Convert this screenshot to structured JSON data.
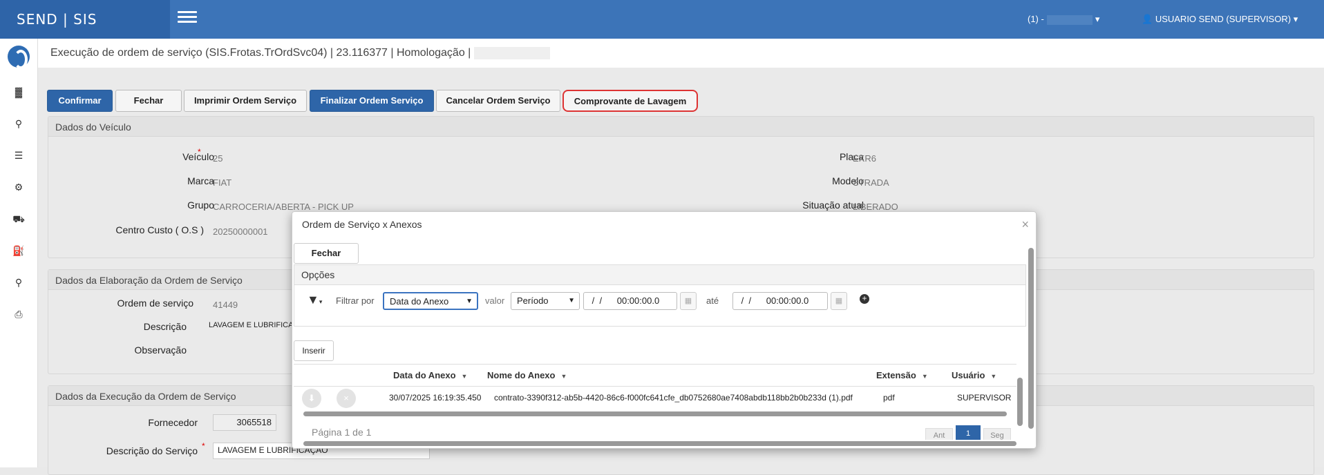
{
  "topbar": {
    "brand": "SEND | SIS",
    "selector_label": "(1) -",
    "user_label": "USUARIO SEND (SUPERVISOR)"
  },
  "sidebar": {
    "icons": [
      "chart-icon",
      "key-icon",
      "list-icon",
      "cogs-icon",
      "truck-icon",
      "gas-pump-icon",
      "search-icon",
      "print-icon"
    ]
  },
  "page": {
    "title": "Execução de ordem de serviço (SIS.Frotas.TrOrdSvc04) | 23.116377 | Homologação |"
  },
  "toolbar": {
    "confirm": "Confirmar",
    "close": "Fechar",
    "print": "Imprimir Ordem Serviço",
    "finish": "Finalizar Ordem Serviço",
    "cancel": "Cancelar Ordem Serviço",
    "wash_receipt": "Comprovante de Lavagem"
  },
  "vehicle": {
    "header": "Dados do Veículo",
    "veiculo_label": "Veículo",
    "veiculo_value": "25",
    "marca_label": "Marca",
    "marca_value": "FIAT",
    "grupo_label": "Grupo",
    "grupo_value": "CARROCERIA/ABERTA - PICK UP",
    "centro_label": "Centro Custo ( O.S )",
    "centro_value": "20250000001",
    "placa_label": "Placa",
    "placa_value": "EKR6",
    "modelo_label": "Modelo",
    "modelo_value": "STRADA",
    "situacao_label": "Situação atual",
    "situacao_value": "LIBERADO"
  },
  "elaboration": {
    "header": "Dados da Elaboração da Ordem de Serviço",
    "os_label": "Ordem de serviço",
    "os_value": "41449",
    "descricao_label": "Descrição",
    "descricao_value": "LAVAGEM E LUBRIFICAÇ",
    "observacao_label": "Observação"
  },
  "execution": {
    "header": "Dados da Execução da Ordem de Serviço",
    "fornecedor_label": "Fornecedor",
    "fornecedor_value": "3065518",
    "desc_servico_label": "Descrição do Serviço",
    "desc_servico_value": "LAVAGEM E LUBRIFICAÇÃO"
  },
  "modal": {
    "title": "Ordem de Serviço x Anexos",
    "close_button": "Fechar",
    "options_header": "Opções",
    "filter_label": "Filtrar por",
    "filter_value": "Data do Anexo",
    "valor_label": "valor",
    "periodo_value": "Período",
    "date_from": " /  /      00:00:00.0",
    "ate_label": "até",
    "date_to": " /  /      00:00:00.0",
    "insert_button": "Inserir",
    "columns": [
      "Data do Anexo",
      "Nome do Anexo",
      "Extensão",
      "Usuário"
    ],
    "rows": [
      {
        "data": "30/07/2025 16:19:35.450",
        "nome": "contrato-3390f312-ab5b-4420-86c6-f000fc641cfe_db0752680ae7408abdb118bb2b0b233d (1).pdf",
        "ext": "pdf",
        "usuario": "SUPERVISOR"
      }
    ],
    "pager_text": "Página 1 de 1",
    "pager_prev": "Ant",
    "pager_page": "1",
    "pager_next": "Seg"
  },
  "colors": {
    "topbar": "#3c74b8",
    "primary_button": "#2e65a8",
    "highlight_border": "#dd3333"
  }
}
